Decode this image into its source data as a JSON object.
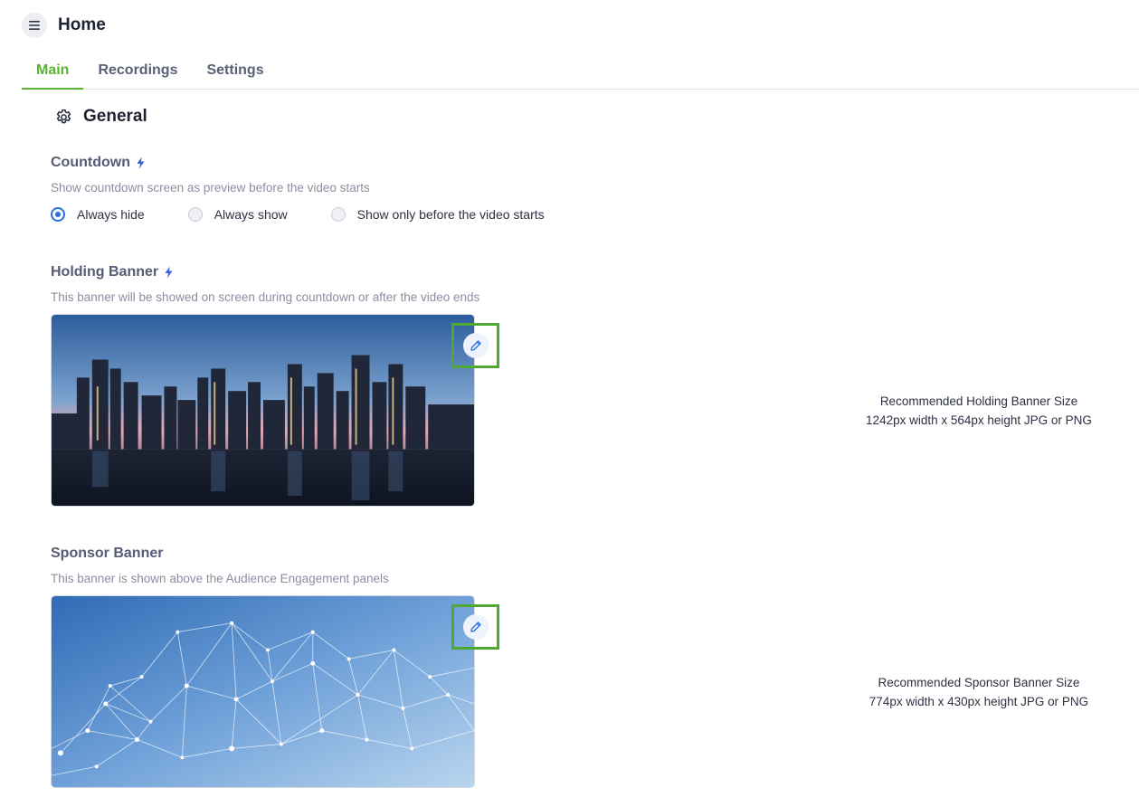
{
  "header": {
    "title": "Home",
    "menu_icon": "hamburger-menu-icon"
  },
  "tabs": [
    {
      "label": "Main",
      "active": true
    },
    {
      "label": "Recordings",
      "active": false
    },
    {
      "label": "Settings",
      "active": false
    }
  ],
  "general": {
    "title": "General",
    "icon": "gear-icon"
  },
  "countdown": {
    "title": "Countdown",
    "description": "Show countdown screen as preview before the video starts",
    "options": [
      {
        "label": "Always hide",
        "selected": true
      },
      {
        "label": "Always show",
        "selected": false
      },
      {
        "label": "Show only before the video starts",
        "selected": false
      }
    ]
  },
  "holding_banner": {
    "title": "Holding Banner",
    "description": "This banner will be showed on screen during countdown or after the video ends",
    "recommended_title": "Recommended Holding Banner Size",
    "recommended_size": "1242px width x 564px height JPG or PNG"
  },
  "sponsor_banner": {
    "title": "Sponsor Banner",
    "description": "This banner is shown above the Audience Engagement panels",
    "recommended_title": "Recommended Sponsor Banner Size",
    "recommended_size": "774px width x 430px height JPG or PNG"
  },
  "colors": {
    "accent_green": "#58b331",
    "radio_blue": "#2a6fe0",
    "highlight_frame": "#4fa832"
  }
}
